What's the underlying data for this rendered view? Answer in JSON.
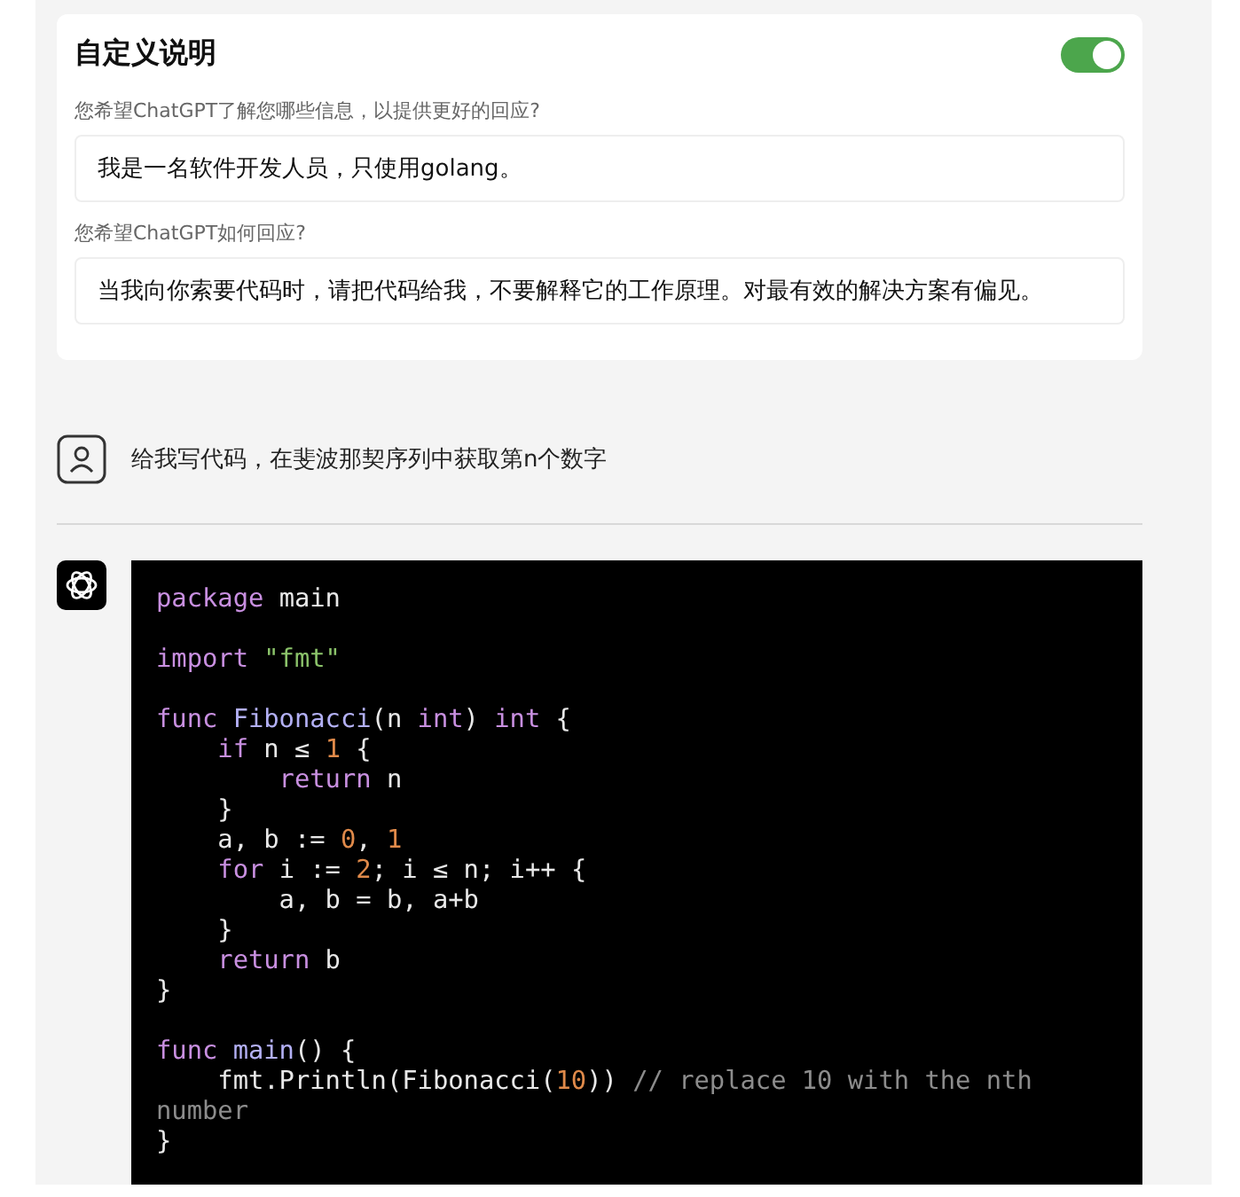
{
  "custom_instructions": {
    "title": "自定义说明",
    "enabled": true,
    "fields": [
      {
        "label": "您希望ChatGPT了解您哪些信息，以提供更好的回应?",
        "value": "我是一名软件开发人员，只使用golang。"
      },
      {
        "label": "您希望ChatGPT如何回应?",
        "value": "当我向你索要代码时，请把代码给我，不要解释它的工作原理。对最有效的解决方案有偏见。"
      }
    ]
  },
  "user_message": {
    "text": "给我写代码，在斐波那契序列中获取第n个数字"
  },
  "assistant_code": {
    "blocks": [
      {
        "lines": [
          {
            "tokens": [
              {
                "text": "package",
                "color": "#c88fe0"
              },
              {
                "text": " main",
                "color": "#e8e8e8"
              }
            ]
          }
        ]
      },
      {
        "lines": [
          {
            "tokens": [
              {
                "text": "import",
                "color": "#c88fe0"
              },
              {
                "text": " \"fmt\"",
                "color": "#8bc36a"
              }
            ]
          }
        ]
      },
      {
        "lines": [
          {
            "tokens": [
              {
                "text": "func",
                "color": "#c88fe0"
              },
              {
                "text": " Fibonacci",
                "color": "#b3b0f5"
              },
              {
                "text": "(n ",
                "color": "#e8e8e8"
              },
              {
                "text": "int",
                "color": "#c88fe0"
              },
              {
                "text": ") ",
                "color": "#e8e8e8"
              },
              {
                "text": "int",
                "color": "#c88fe0"
              },
              {
                "text": " {",
                "color": "#e8e8e8"
              }
            ]
          },
          {
            "tokens": [
              {
                "text": "    if",
                "color": "#c88fe0"
              },
              {
                "text": " n ≤ ",
                "color": "#e8e8e8"
              },
              {
                "text": "1",
                "color": "#e08a4a"
              },
              {
                "text": " {",
                "color": "#e8e8e8"
              }
            ]
          },
          {
            "tokens": [
              {
                "text": "        return",
                "color": "#c88fe0"
              },
              {
                "text": " n",
                "color": "#e8e8e8"
              }
            ]
          },
          {
            "tokens": [
              {
                "text": "    }",
                "color": "#e8e8e8"
              }
            ]
          },
          {
            "tokens": [
              {
                "text": "    a, b := ",
                "color": "#e8e8e8"
              },
              {
                "text": "0",
                "color": "#e08a4a"
              },
              {
                "text": ", ",
                "color": "#e8e8e8"
              },
              {
                "text": "1",
                "color": "#e08a4a"
              }
            ]
          },
          {
            "tokens": [
              {
                "text": "    for",
                "color": "#c88fe0"
              },
              {
                "text": " i := ",
                "color": "#e8e8e8"
              },
              {
                "text": "2",
                "color": "#e08a4a"
              },
              {
                "text": "; i ≤ n; i++ {",
                "color": "#e8e8e8"
              }
            ]
          },
          {
            "tokens": [
              {
                "text": "        a, b = b, a+b",
                "color": "#e8e8e8"
              }
            ]
          },
          {
            "tokens": [
              {
                "text": "    }",
                "color": "#e8e8e8"
              }
            ]
          },
          {
            "tokens": [
              {
                "text": "    return",
                "color": "#c88fe0"
              },
              {
                "text": " b",
                "color": "#e8e8e8"
              }
            ]
          },
          {
            "tokens": [
              {
                "text": "}",
                "color": "#e8e8e8"
              }
            ]
          }
        ]
      },
      {
        "lines": [
          {
            "tokens": [
              {
                "text": "func",
                "color": "#c88fe0"
              },
              {
                "text": " main",
                "color": "#b3b0f5"
              },
              {
                "text": "() {",
                "color": "#e8e8e8"
              }
            ]
          },
          {
            "tokens": [
              {
                "text": "    fmt.Println(Fibonacci(",
                "color": "#e8e8e8"
              },
              {
                "text": "10",
                "color": "#e08a4a"
              },
              {
                "text": ")) ",
                "color": "#e8e8e8"
              },
              {
                "text": "// replace 10 with the nth",
                "color": "#8c8c8c"
              }
            ]
          },
          {
            "tokens": [
              {
                "text": "number",
                "color": "#8c8c8c"
              }
            ]
          },
          {
            "tokens": [
              {
                "text": "}",
                "color": "#e8e8e8"
              }
            ]
          }
        ]
      }
    ]
  }
}
